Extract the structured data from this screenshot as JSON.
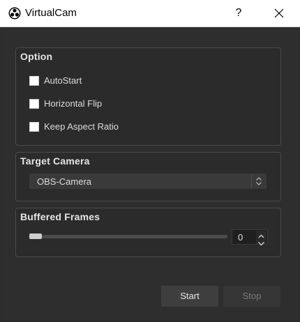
{
  "window": {
    "title": "VirtualCam",
    "help_label": "?"
  },
  "options": {
    "title": "Option",
    "items": [
      {
        "label": "AutoStart",
        "checked": false
      },
      {
        "label": "Horizontal Flip",
        "checked": false
      },
      {
        "label": "Keep Aspect Ratio",
        "checked": false
      }
    ]
  },
  "target_camera": {
    "title": "Target Camera",
    "selected": "OBS-Camera"
  },
  "buffered_frames": {
    "title": "Buffered Frames",
    "value": "0"
  },
  "buttons": {
    "start": "Start",
    "stop": "Stop"
  },
  "icons": {
    "app": "obs-logo-icon",
    "close": "close-icon",
    "combo": "updown-arrows-icon",
    "spin_up": "chevron-up-icon",
    "spin_down": "chevron-down-icon"
  },
  "colors": {
    "dialog_bg": "#2e2e2e",
    "group_bg": "#2b2b2b",
    "text": "#dcdcdc",
    "disabled_text": "#7a7a7a"
  }
}
